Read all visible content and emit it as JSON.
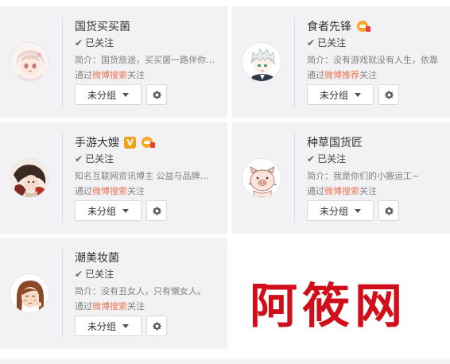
{
  "colors": {
    "card_bg": "#f2f2f5",
    "source_link": "#eb7350",
    "watermark": "#d10f1b"
  },
  "cards": [
    {
      "name": "国货买买菌",
      "badges": [],
      "followed": "已关注",
      "intro": "简介：国货旅途，买买菌一路伴你…",
      "via_prefix": "通过",
      "via_source": "微博搜索",
      "via_suffix": "关注",
      "group_label": "未分组",
      "avatar": "anime-girl-pink-hair"
    },
    {
      "name": "食者先锋",
      "badges": [
        "crown-badge"
      ],
      "followed": "已关注",
      "intro": "简介：没有游戏就没有人生，依靠",
      "via_prefix": "通过",
      "via_source": "微博推荐",
      "via_suffix": "关注",
      "group_label": "未分组",
      "avatar": "anime-boy-white-hair"
    },
    {
      "name": "手游大嫂",
      "badges": [
        "v-badge",
        "crown-badge"
      ],
      "v_badge_text": "V",
      "followed": "已关注",
      "intro": "知名互联网资讯博主 公益与品牌…",
      "via_prefix": "通过",
      "via_source": "微博搜索",
      "via_suffix": "关注",
      "group_label": "未分组",
      "avatar": "illustration-dark"
    },
    {
      "name": "种草国货匠",
      "badges": [],
      "followed": "已关注",
      "intro": "简介：我是你们的小搬运工~",
      "via_prefix": "通过",
      "via_source": "微博搜索",
      "via_suffix": "关注",
      "group_label": "未分组",
      "avatar": "cartoon-pig"
    },
    {
      "name": "潮美妆菌",
      "badges": [],
      "followed": "已关注",
      "intro": "简介：没有丑女人，只有懒女人。",
      "via_prefix": "通过",
      "via_source": "微博搜索",
      "via_suffix": "关注",
      "group_label": "未分组",
      "avatar": "cartoon-woman-face"
    }
  ],
  "watermark": "阿筱网"
}
